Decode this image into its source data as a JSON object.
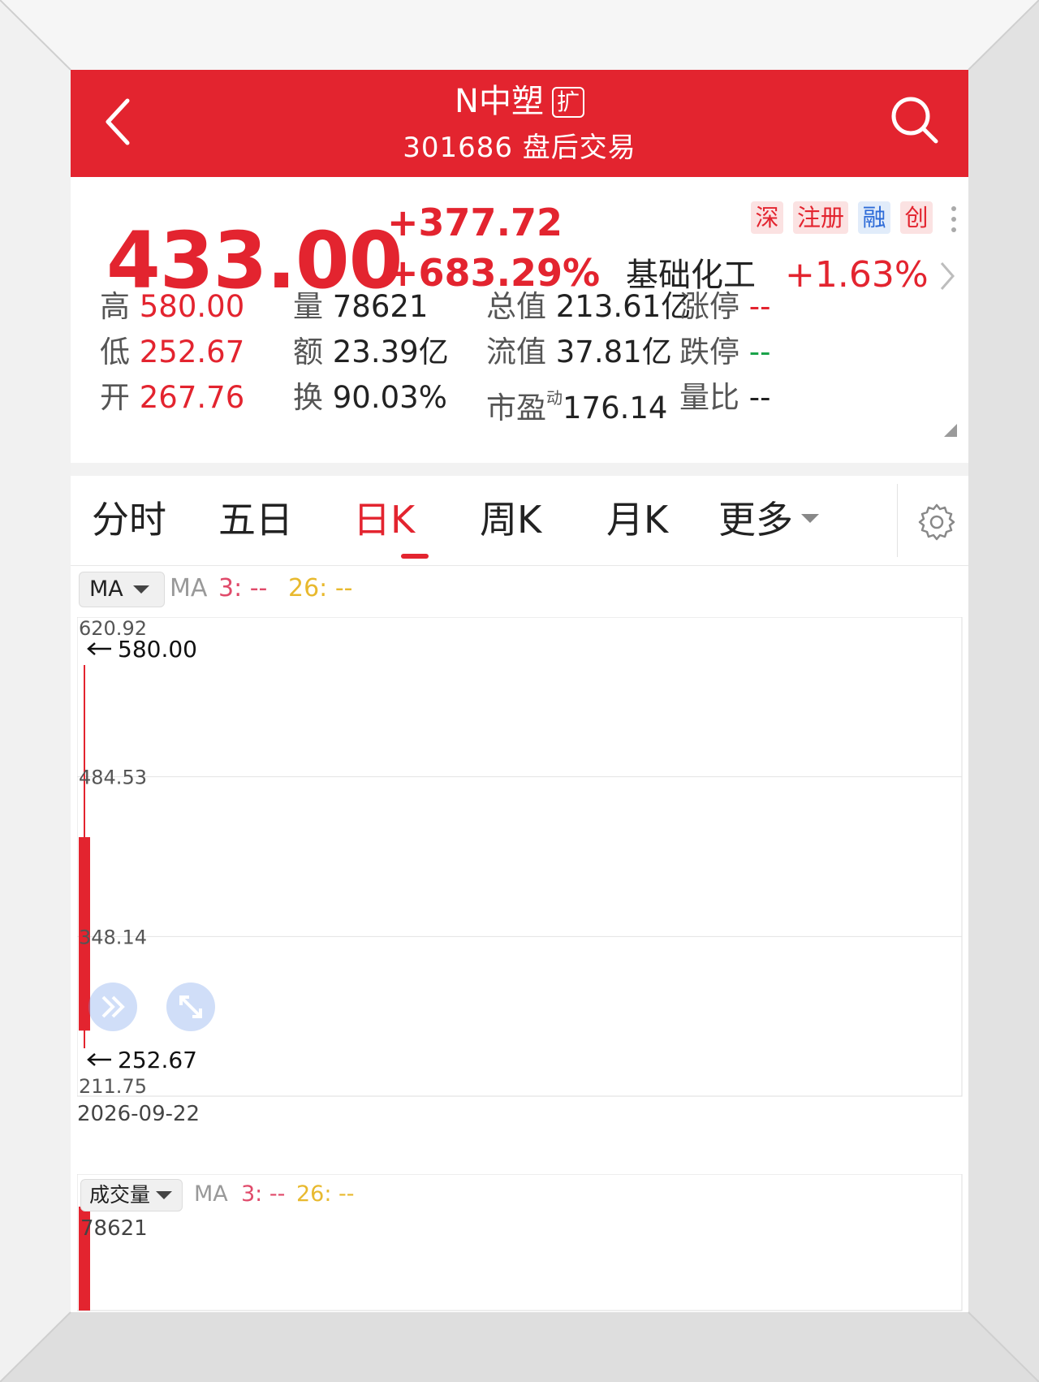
{
  "header": {
    "title": "N中塑",
    "tag": "扩",
    "subtitle": "301686 盘后交易"
  },
  "quote": {
    "price": "433.00",
    "change": "+377.72",
    "change_pct": "+683.29%",
    "badges": [
      "深",
      "注册",
      "融",
      "创"
    ],
    "sector": "基础化工",
    "sector_change": "+1.63%",
    "stats": {
      "high_label": "高",
      "high": "580.00",
      "low_label": "低",
      "low": "252.67",
      "open_label": "开",
      "open": "267.76",
      "vol_label": "量",
      "vol": "78621",
      "amount_label": "额",
      "amount": "23.39亿",
      "turnover_label": "换",
      "turnover": "90.03%",
      "mktcap_label": "总值",
      "mktcap": "213.61亿",
      "float_label": "流值",
      "float": "37.81亿",
      "pe_label": "市盈",
      "pe_sup": "动",
      "pe": "176.14",
      "limit_up_label": "涨停",
      "limit_up": "--",
      "limit_down_label": "跌停",
      "limit_down": "--",
      "vol_ratio_label": "量比",
      "vol_ratio": "--"
    }
  },
  "tabs": [
    "分时",
    "五日",
    "日K",
    "周K",
    "月K",
    "更多"
  ],
  "active_tab": "日K",
  "indicator": {
    "selector": "MA",
    "ma_label": "MA",
    "ma3": "3: --",
    "ma26": "26: --"
  },
  "volume_indicator": {
    "selector": "成交量",
    "ma_label": "MA",
    "ma3": "3: --",
    "ma26": "26: --"
  },
  "colors": {
    "up": "#e3242f",
    "header": "#e3242f",
    "ma3": "#e04a6a",
    "ma26": "#e8b92e",
    "down": "#1aa34a"
  },
  "chart_data": [
    {
      "type": "candlestick",
      "x": [
        "2026-09-22"
      ],
      "open": [
        267.76
      ],
      "close": [
        433.0
      ],
      "high": [
        580.0
      ],
      "low": [
        252.67
      ],
      "ylim": [
        211.75,
        620.92
      ],
      "yticks": [
        "620.92",
        "484.53",
        "348.14",
        "211.75"
      ],
      "annotations": [
        "580.00",
        "252.67"
      ],
      "date_label": "2026-09-22"
    },
    {
      "type": "bar",
      "x": [
        "2026-09-22"
      ],
      "values": [
        78621
      ],
      "ymax_label": "78621"
    }
  ]
}
